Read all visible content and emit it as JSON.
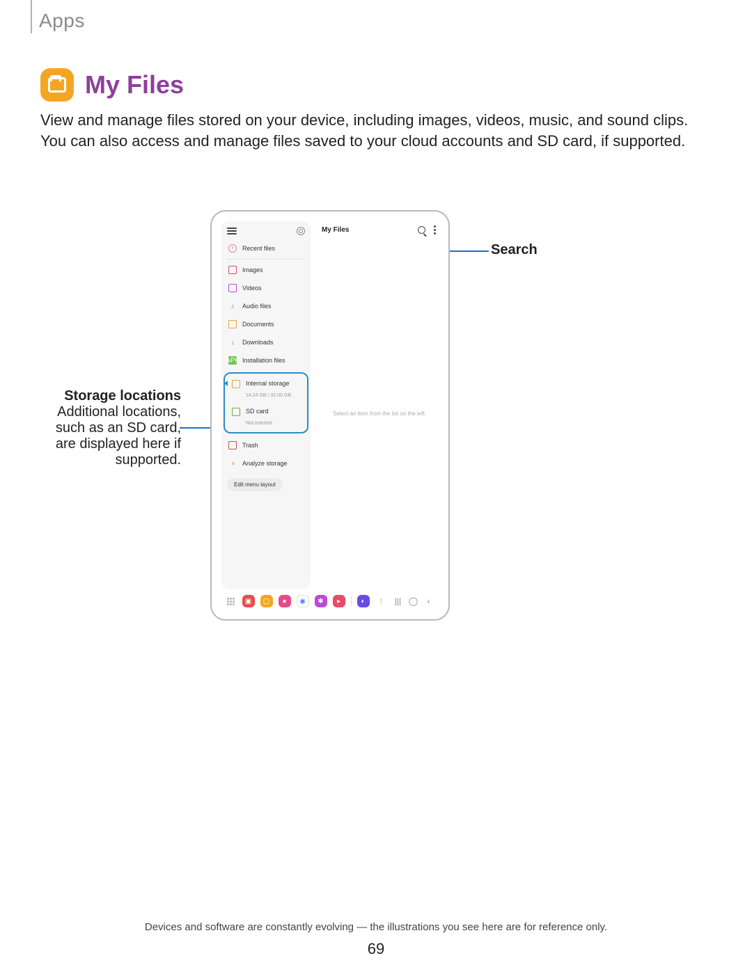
{
  "section": "Apps",
  "heading": "My Files",
  "icon_color": "#f4a623",
  "body": "View and manage files stored on your device, including images, videos, music, and sound clips. You can also access and manage files saved to your cloud accounts and SD card, if supported.",
  "callouts": {
    "search": "Search",
    "storage_title": "Storage locations",
    "storage_body": "Additional locations, such as an SD card, are displayed here if supported."
  },
  "phone": {
    "app_title": "My Files",
    "empty_hint": "Select an item from the list on the left.",
    "sidebar": {
      "recent": "Recent files",
      "images": "Images",
      "videos": "Videos",
      "audio": "Audio files",
      "documents": "Documents",
      "downloads": "Downloads",
      "installation": "Installation files",
      "internal": "Internal storage",
      "internal_sub": "14.24 GB / 32.00 GB",
      "sdcard": "SD card",
      "sdcard_sub": "Not inserted",
      "trash": "Trash",
      "analyze": "Analyze storage",
      "edit": "Edit menu layout",
      "apk_badge": "APK"
    },
    "nav_colors": [
      "#e84b4b",
      "#f4a623",
      "#e84b8a",
      "#fff",
      "#b94bd9",
      "#e84b6a",
      "#6a4be8",
      "#fff"
    ]
  },
  "footer": "Devices and software are constantly evolving — the illustrations you see here are for reference only.",
  "page_number": "69"
}
